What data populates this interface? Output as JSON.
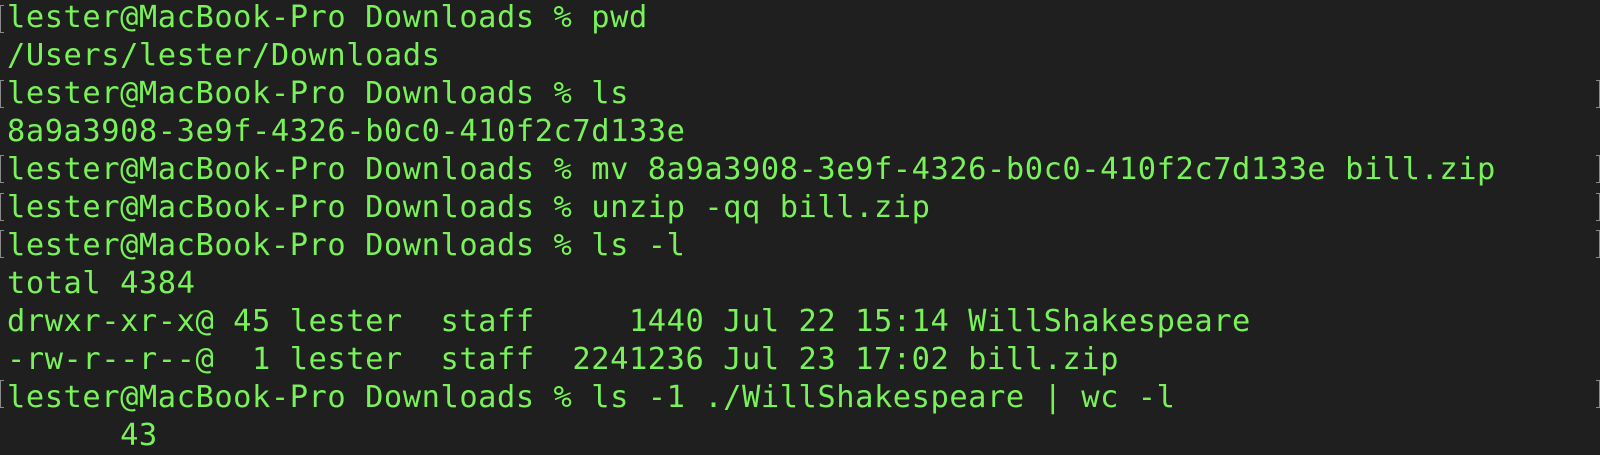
{
  "terminal": {
    "colors": {
      "background": "#1f1f1f",
      "text": "#79f25a"
    },
    "lines": [
      "lester@MacBook-Pro Downloads % pwd",
      "/Users/lester/Downloads",
      "lester@MacBook-Pro Downloads % ls",
      "8a9a3908-3e9f-4326-b0c0-410f2c7d133e",
      "lester@MacBook-Pro Downloads % mv 8a9a3908-3e9f-4326-b0c0-410f2c7d133e bill.zip",
      "lester@MacBook-Pro Downloads % unzip -qq bill.zip",
      "lester@MacBook-Pro Downloads % ls -l",
      "total 4384",
      "drwxr-xr-x@ 45 lester  staff     1440 Jul 22 15:14 WillShakespeare",
      "-rw-r--r--@  1 lester  staff  2241236 Jul 23 17:02 bill.zip",
      "lester@MacBook-Pro Downloads % ls -1 ./WillShakespeare | wc -l",
      "      43"
    ]
  }
}
